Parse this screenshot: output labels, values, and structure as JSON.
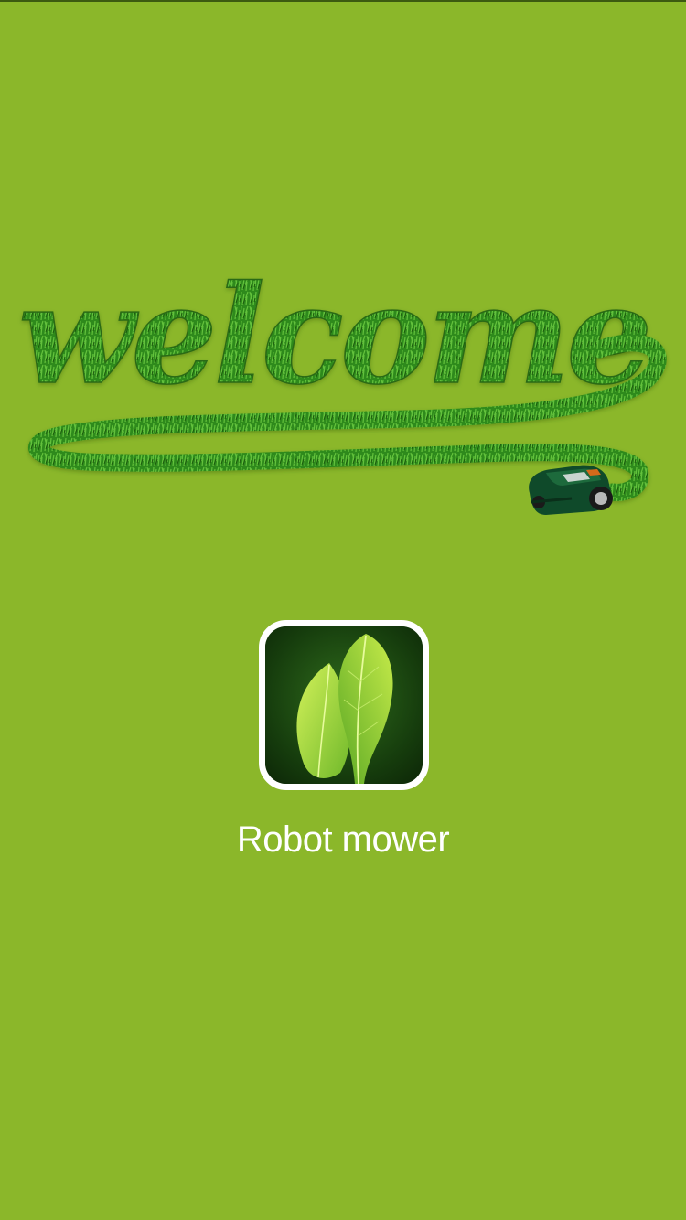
{
  "splash": {
    "background_color": "#8BB72A",
    "welcome_text": "welcome",
    "welcome_icon": "grass-welcome-lettering-icon",
    "mower_icon": "robot-mower-icon",
    "app_icon": "leaf-app-icon",
    "app_name": "Robot mower"
  }
}
